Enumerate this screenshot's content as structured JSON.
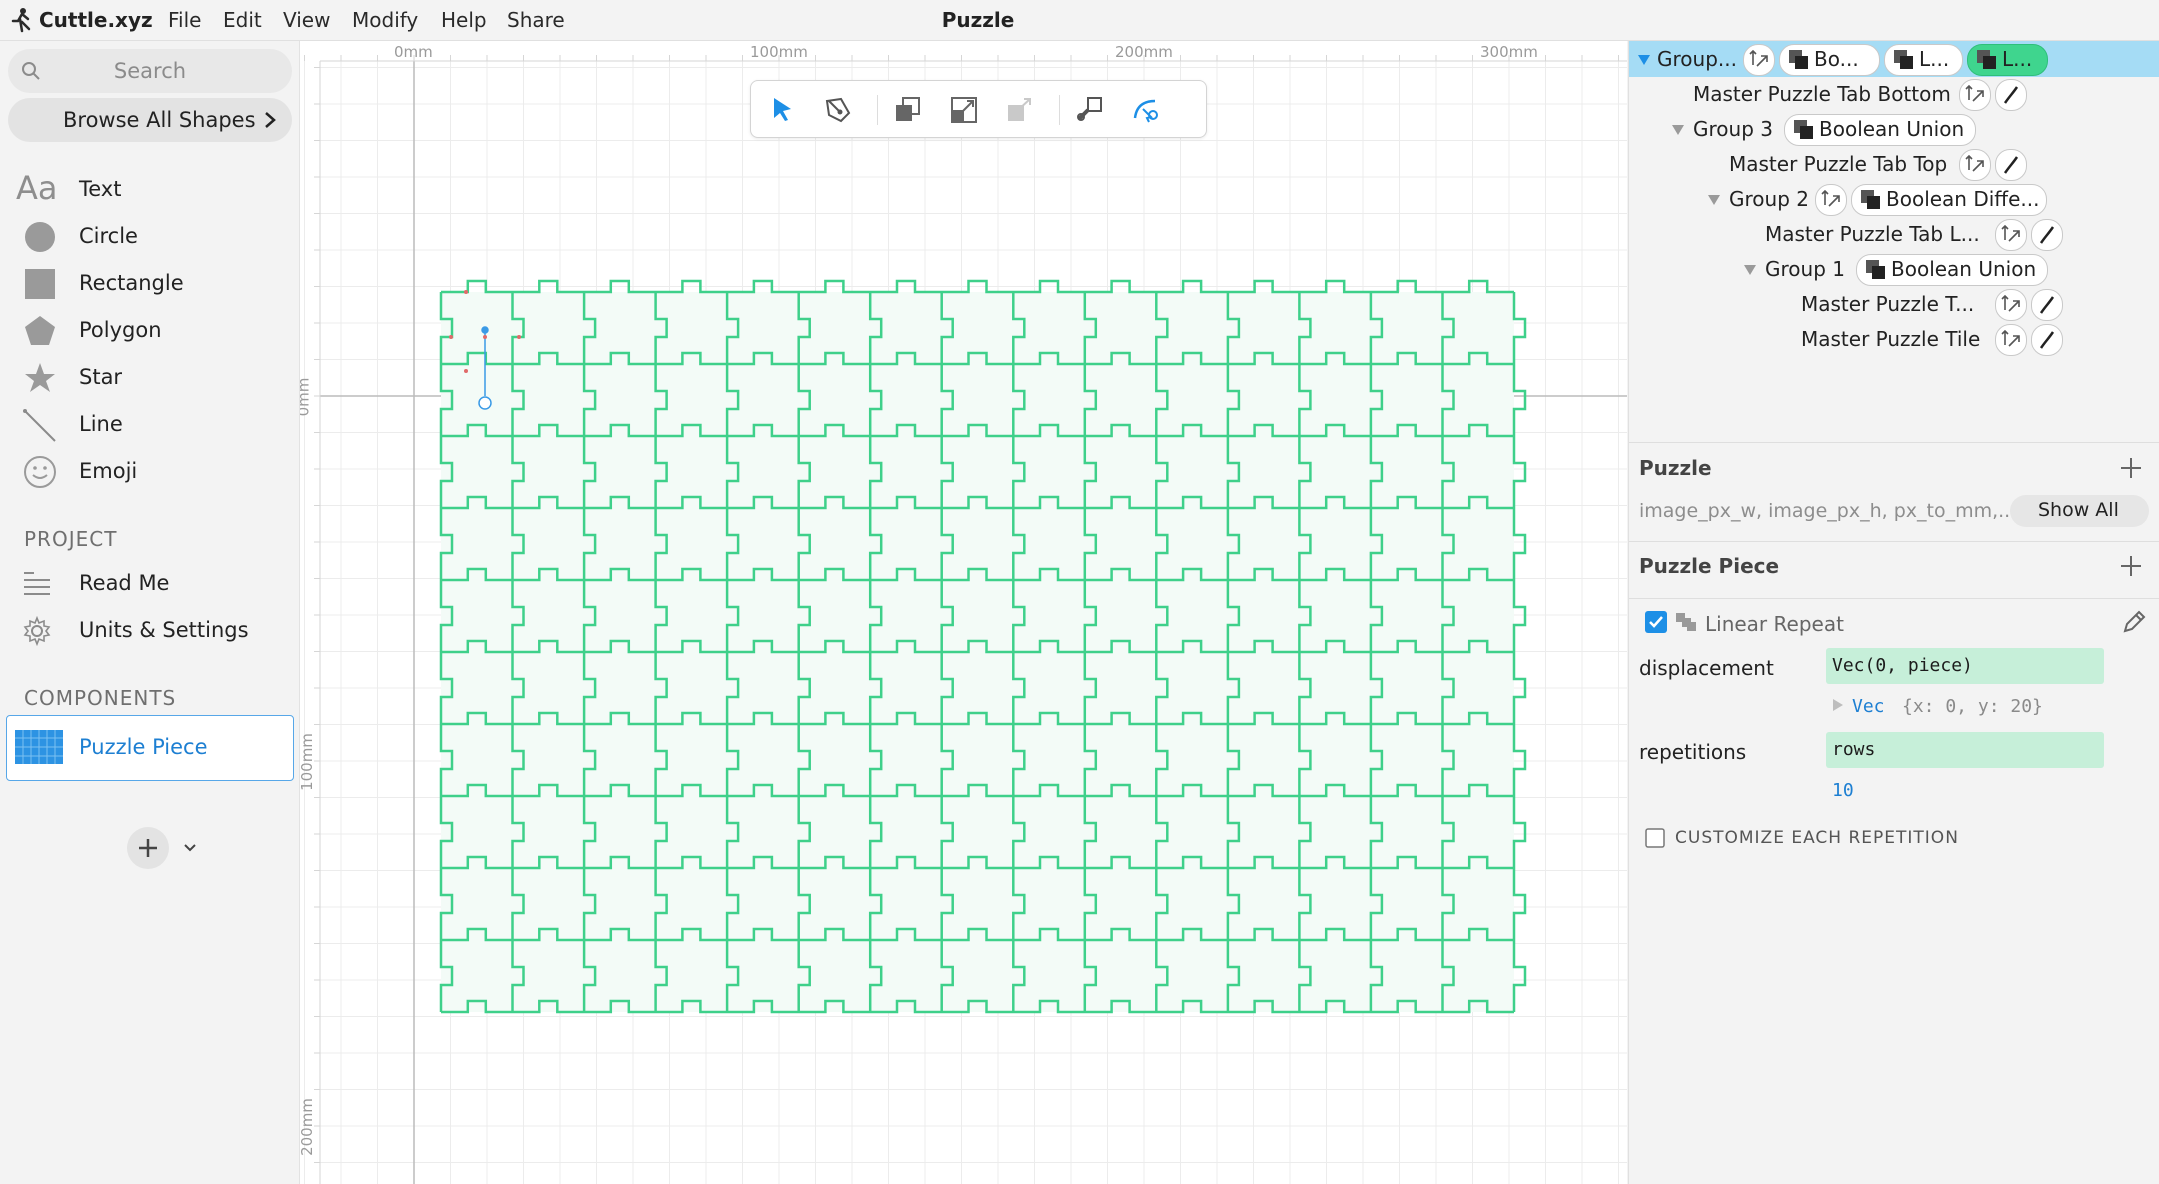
{
  "app": {
    "name": "Cuttle.xyz",
    "menu": [
      "File",
      "Edit",
      "View",
      "Modify",
      "Help",
      "Share"
    ],
    "document_title": "Puzzle",
    "accent_color": "#1d7fd2",
    "shape_stroke_color": "#3ed08a"
  },
  "sidebar": {
    "search_placeholder": "Search",
    "browse_label": "Browse All Shapes",
    "shapes": [
      {
        "label": "Text",
        "icon": "text-aa-icon"
      },
      {
        "label": "Circle",
        "icon": "circle-icon"
      },
      {
        "label": "Rectangle",
        "icon": "rectangle-icon"
      },
      {
        "label": "Polygon",
        "icon": "pentagon-icon"
      },
      {
        "label": "Star",
        "icon": "star-icon"
      },
      {
        "label": "Line",
        "icon": "line-icon"
      },
      {
        "label": "Emoji",
        "icon": "emoji-icon"
      }
    ],
    "project_header": "PROJECT",
    "project_items": [
      {
        "label": "Read Me",
        "icon": "document-lines-icon"
      },
      {
        "label": "Units & Settings",
        "icon": "gear-icon"
      }
    ],
    "components_header": "COMPONENTS",
    "components": [
      {
        "label": "Puzzle Piece",
        "selected": true
      }
    ]
  },
  "ruler": {
    "horizontal": [
      "0mm",
      "100mm",
      "200mm",
      "300mm"
    ],
    "vertical": [
      "0mm",
      "100mm",
      "200mm"
    ]
  },
  "toolbar": {
    "tools": [
      "select-arrow-icon",
      "pen-icon",
      "bring-forward-icon",
      "scale-icon",
      "send-backward-icon",
      "boolean-icon",
      "node-edit-icon"
    ]
  },
  "puzzle": {
    "columns": 15,
    "rows": 10
  },
  "layers": {
    "rows": [
      {
        "name": "Group...",
        "depth": 0,
        "expanded": true,
        "selected": true,
        "chips": [
          "Bo...",
          "L...",
          "L..."
        ]
      },
      {
        "name": "Master Puzzle Tab Bottom",
        "depth": 1,
        "chips": []
      },
      {
        "name": "Group 3",
        "depth": 1,
        "expanded": true,
        "chips": [
          "Boolean Union"
        ]
      },
      {
        "name": "Master Puzzle Tab Top",
        "depth": 2,
        "chips": []
      },
      {
        "name": "Group 2",
        "depth": 2,
        "expanded": true,
        "chips": [
          "Boolean Diffe..."
        ]
      },
      {
        "name": "Master Puzzle Tab L...",
        "depth": 3,
        "chips": []
      },
      {
        "name": "Group 1",
        "depth": 3,
        "expanded": true,
        "chips": [
          "Boolean Union"
        ]
      },
      {
        "name": "Master Puzzle T...",
        "depth": 4,
        "chips": []
      },
      {
        "name": "Master Puzzle Tile",
        "depth": 4,
        "chips": []
      }
    ]
  },
  "inspector": {
    "puzzle_title": "Puzzle",
    "puzzle_params": "image_px_w, image_px_h, px_to_mm,...",
    "show_all_label": "Show All",
    "piece_title": "Puzzle Piece",
    "modifier": {
      "enabled": true,
      "label": "Linear Repeat"
    },
    "displacement_label": "displacement",
    "displacement_expr": "Vec(0, piece)",
    "displacement_result_type": "Vec",
    "displacement_result_body": "{x: 0, y: 20}",
    "repetitions_label": "repetitions",
    "repetitions_expr": "rows",
    "repetitions_result": "10",
    "customize_label": "CUSTOMIZE EACH REPETITION",
    "customize_checked": false
  }
}
